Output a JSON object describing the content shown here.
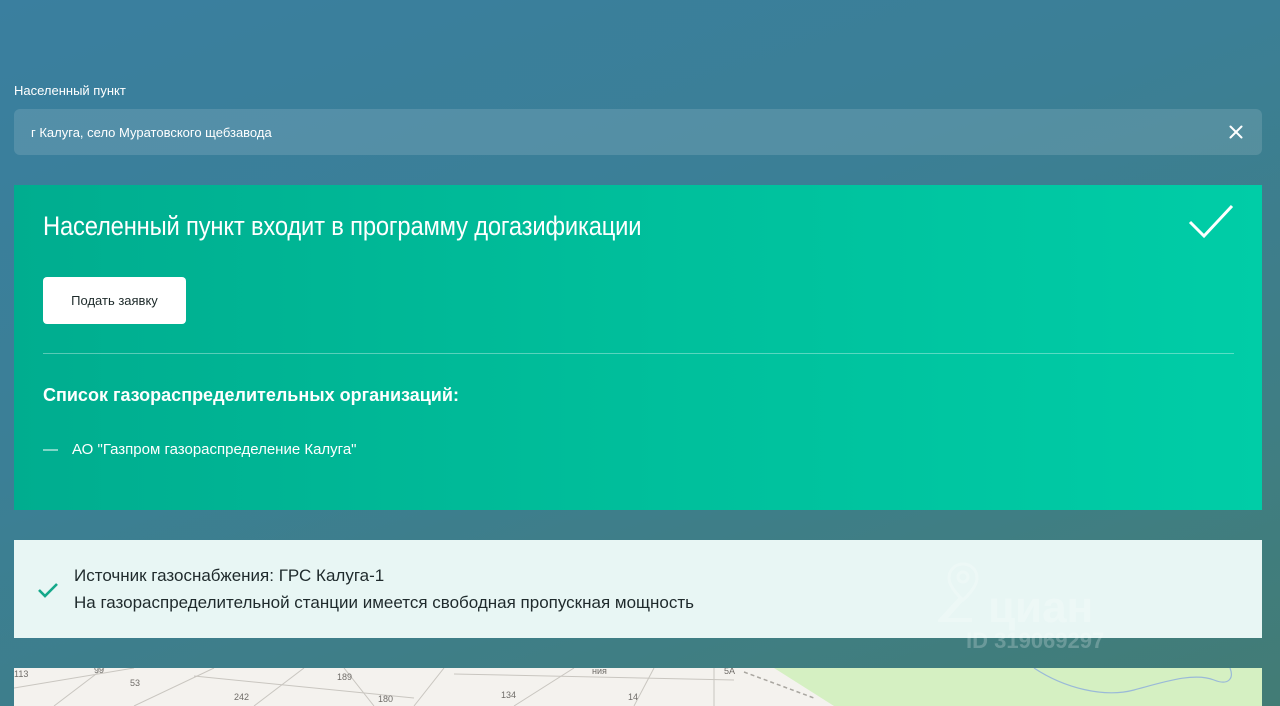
{
  "search": {
    "label": "Населенный пункт",
    "value": "г Калуга, село Муратовского щебзавода"
  },
  "status_card": {
    "title": "Населенный пункт входит в программу догазификации",
    "apply_label": "Подать заявку",
    "orgs_heading": "Список газораспределительных организаций:",
    "orgs": [
      "АО \"Газпром газораспределение Калуга\""
    ],
    "accent_color": "#00c4a0"
  },
  "info_card": {
    "source": "Источник газоснабжения: ГРС Калуга-1",
    "capacity": "На газораспределительной станции имеется свободная пропускная мощность",
    "check_color": "#14a88a"
  },
  "watermark": {
    "brand": "циан",
    "id_text": "ID 319069297"
  },
  "map": {
    "labels": [
      "113",
      "99",
      "53",
      "242",
      "189",
      "180",
      "134",
      "14",
      "5А",
      "ния"
    ]
  }
}
